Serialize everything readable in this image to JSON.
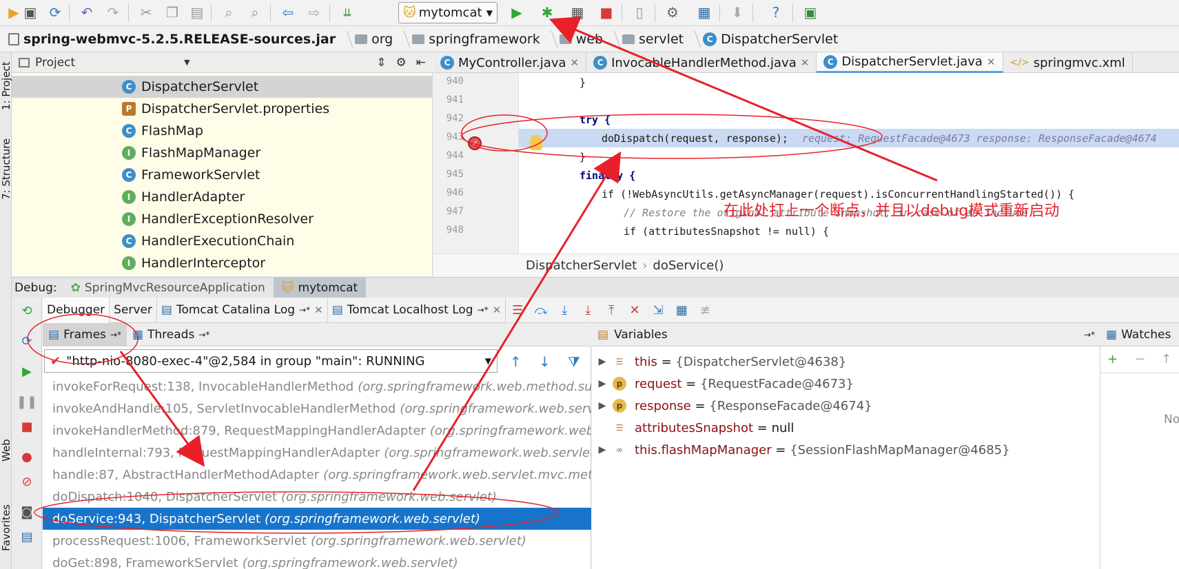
{
  "toolbar": {
    "run_config": "mytomcat",
    "icons": [
      "save-icon",
      "sync-icon",
      "undo-icon",
      "redo-icon",
      "cut-icon",
      "copy-icon",
      "paste-icon",
      "find-icon",
      "replace-icon",
      "back-icon",
      "forward-icon",
      "make-icon",
      "run-config-icon",
      "run-icon",
      "debug-icon",
      "coverage-icon",
      "stop-icon",
      "project-structure-icon",
      "settings-icon",
      "sdk-icon",
      "download-icon",
      "help-icon",
      "plugin-icon"
    ]
  },
  "breadcrumb": [
    "spring-webmvc-5.2.5.RELEASE-sources.jar",
    "org",
    "springframework",
    "web",
    "servlet",
    "DispatcherServlet"
  ],
  "left_stripe": {
    "project": "1: Project",
    "structure": "7: Structure",
    "web": "Web",
    "favorites": "Favorites"
  },
  "project": {
    "header": "Project",
    "items": [
      {
        "label": "DispatcherServlet",
        "kind": "C",
        "selected": true
      },
      {
        "label": "DispatcherServlet.properties",
        "kind": "P"
      },
      {
        "label": "FlashMap",
        "kind": "C"
      },
      {
        "label": "FlashMapManager",
        "kind": "I"
      },
      {
        "label": "FrameworkServlet",
        "kind": "C"
      },
      {
        "label": "HandlerAdapter",
        "kind": "I"
      },
      {
        "label": "HandlerExceptionResolver",
        "kind": "I"
      },
      {
        "label": "HandlerExecutionChain",
        "kind": "C"
      },
      {
        "label": "HandlerInterceptor",
        "kind": "I"
      }
    ]
  },
  "editor": {
    "tabs": [
      {
        "label": "MyController.java",
        "icon": "C"
      },
      {
        "label": "InvocableHandlerMethod.java",
        "icon": "C"
      },
      {
        "label": "DispatcherServlet.java",
        "icon": "C",
        "active": true
      },
      {
        "label": "springmvc.xml",
        "icon": "X"
      }
    ],
    "lines": [
      {
        "n": "940",
        "code": "}"
      },
      {
        "n": "941",
        "code": ""
      },
      {
        "n": "942",
        "code": "try {"
      },
      {
        "n": "943",
        "code": "doDispatch(request, response);",
        "debug": "request: RequestFacade@4673   response: ResponseFacade@4674"
      },
      {
        "n": "944",
        "code": "}"
      },
      {
        "n": "945",
        "code": "finally {"
      },
      {
        "n": "946",
        "code": "if (!WebAsyncUtils.getAsyncManager(request).isConcurrentHandlingStarted()) {"
      },
      {
        "n": "947",
        "code": "// Restore the original attribute snapshot, in case of an include."
      },
      {
        "n": "948",
        "code": "if (attributesSnapshot != null) {"
      }
    ],
    "breadcrumb_class": "DispatcherServlet",
    "breadcrumb_method": "doService()"
  },
  "debug": {
    "label": "Debug:",
    "sessions": [
      "SpringMvcResourceApplication",
      "mytomcat"
    ],
    "tabs": [
      "Debugger",
      "Server",
      "Tomcat Catalina Log",
      "Tomcat Localhost Log"
    ],
    "frames_tab": "Frames",
    "threads_tab": "Threads",
    "thread": "\"http-nio-8080-exec-4\"@2,584 in group \"main\": RUNNING",
    "frames": [
      {
        "method": "invokeForRequest:138, InvocableHandlerMethod",
        "pkg": "(org.springframework.web.method.suppo"
      },
      {
        "method": "invokeAndHandle:105, ServletInvocableHandlerMethod",
        "pkg": "(org.springframework.web.servlet.m"
      },
      {
        "method": "invokeHandlerMethod:879, RequestMappingHandlerAdapter",
        "pkg": "(org.springframework.web.se"
      },
      {
        "method": "handleInternal:793, RequestMappingHandlerAdapter",
        "pkg": "(org.springframework.web.servlet.mv"
      },
      {
        "method": "handle:87, AbstractHandlerMethodAdapter",
        "pkg": "(org.springframework.web.servlet.mvc.method"
      },
      {
        "method": "doDispatch:1040, DispatcherServlet",
        "pkg": "(org.springframework.web.servlet)"
      },
      {
        "method": "doService:943, DispatcherServlet",
        "pkg": "(org.springframework.web.servlet)",
        "selected": true
      },
      {
        "method": "processRequest:1006, FrameworkServlet",
        "pkg": "(org.springframework.web.servlet)"
      },
      {
        "method": "doGet:898, FrameworkServlet",
        "pkg": "(org.springframework.web.servlet)"
      }
    ],
    "variables_header": "Variables",
    "variables": [
      {
        "name": "this",
        "value": "{DispatcherServlet@4638}",
        "expandable": true,
        "icon": "field"
      },
      {
        "name": "request",
        "value": "{RequestFacade@4673}",
        "expandable": true,
        "icon": "param"
      },
      {
        "name": "response",
        "value": "{ResponseFacade@4674}",
        "expandable": true,
        "icon": "param"
      },
      {
        "name": "attributesSnapshot",
        "value": "null",
        "expandable": false,
        "icon": "field"
      },
      {
        "name": "this.flashMapManager",
        "value": "{SessionFlashMapManager@4685}",
        "expandable": true,
        "icon": "watch"
      }
    ],
    "watches_header": "Watches",
    "watches_empty": "No"
  },
  "annotation": "在此处打上一个断点，并且以debug模式重新启动",
  "colors": {
    "accent": "#1874ca",
    "annotation": "#e8202a",
    "project_bg": "#fffde8",
    "highlight": "#c9daf2"
  }
}
